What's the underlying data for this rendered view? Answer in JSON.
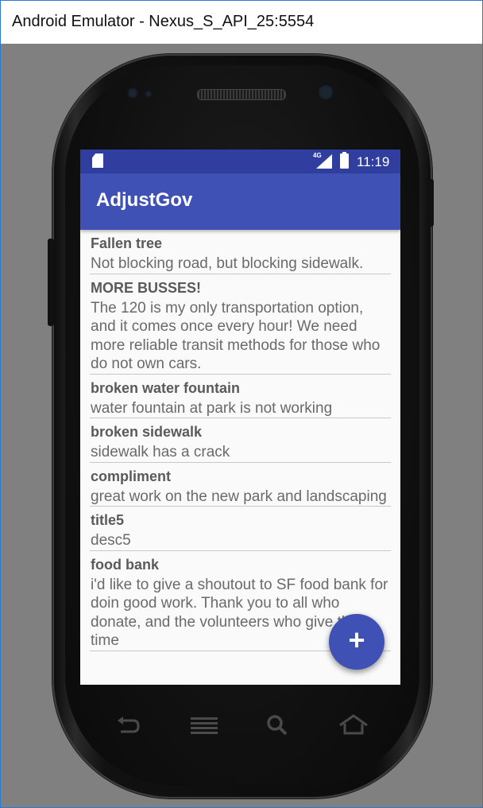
{
  "window": {
    "title": "Android Emulator - Nexus_S_API_25:5554"
  },
  "statusbar": {
    "network": "4G",
    "time": "11:19"
  },
  "app": {
    "title": "AdjustGov"
  },
  "issues": [
    {
      "title": "Fallen tree",
      "description": "Not blocking road, but blocking sidewalk."
    },
    {
      "title": "MORE BUSSES!",
      "description": "The 120 is my only transportation option, and it comes once every hour! We need more reliable transit methods for those who do not own cars."
    },
    {
      "title": "broken water fountain",
      "description": "water fountain at park is not working"
    },
    {
      "title": "broken sidewalk",
      "description": "sidewalk has a crack"
    },
    {
      "title": "compliment",
      "description": "great work on the new park and landscaping"
    },
    {
      "title": "title5",
      "description": "desc5"
    },
    {
      "title": "food bank",
      "description": "i'd like to give a shoutout to SF food bank for doin good work. Thank you to all who donate, and the volunteers who give their time"
    }
  ],
  "fab": {
    "label": "+"
  },
  "navkeys": [
    "back-icon",
    "menu-icon",
    "search-icon",
    "home-icon"
  ]
}
